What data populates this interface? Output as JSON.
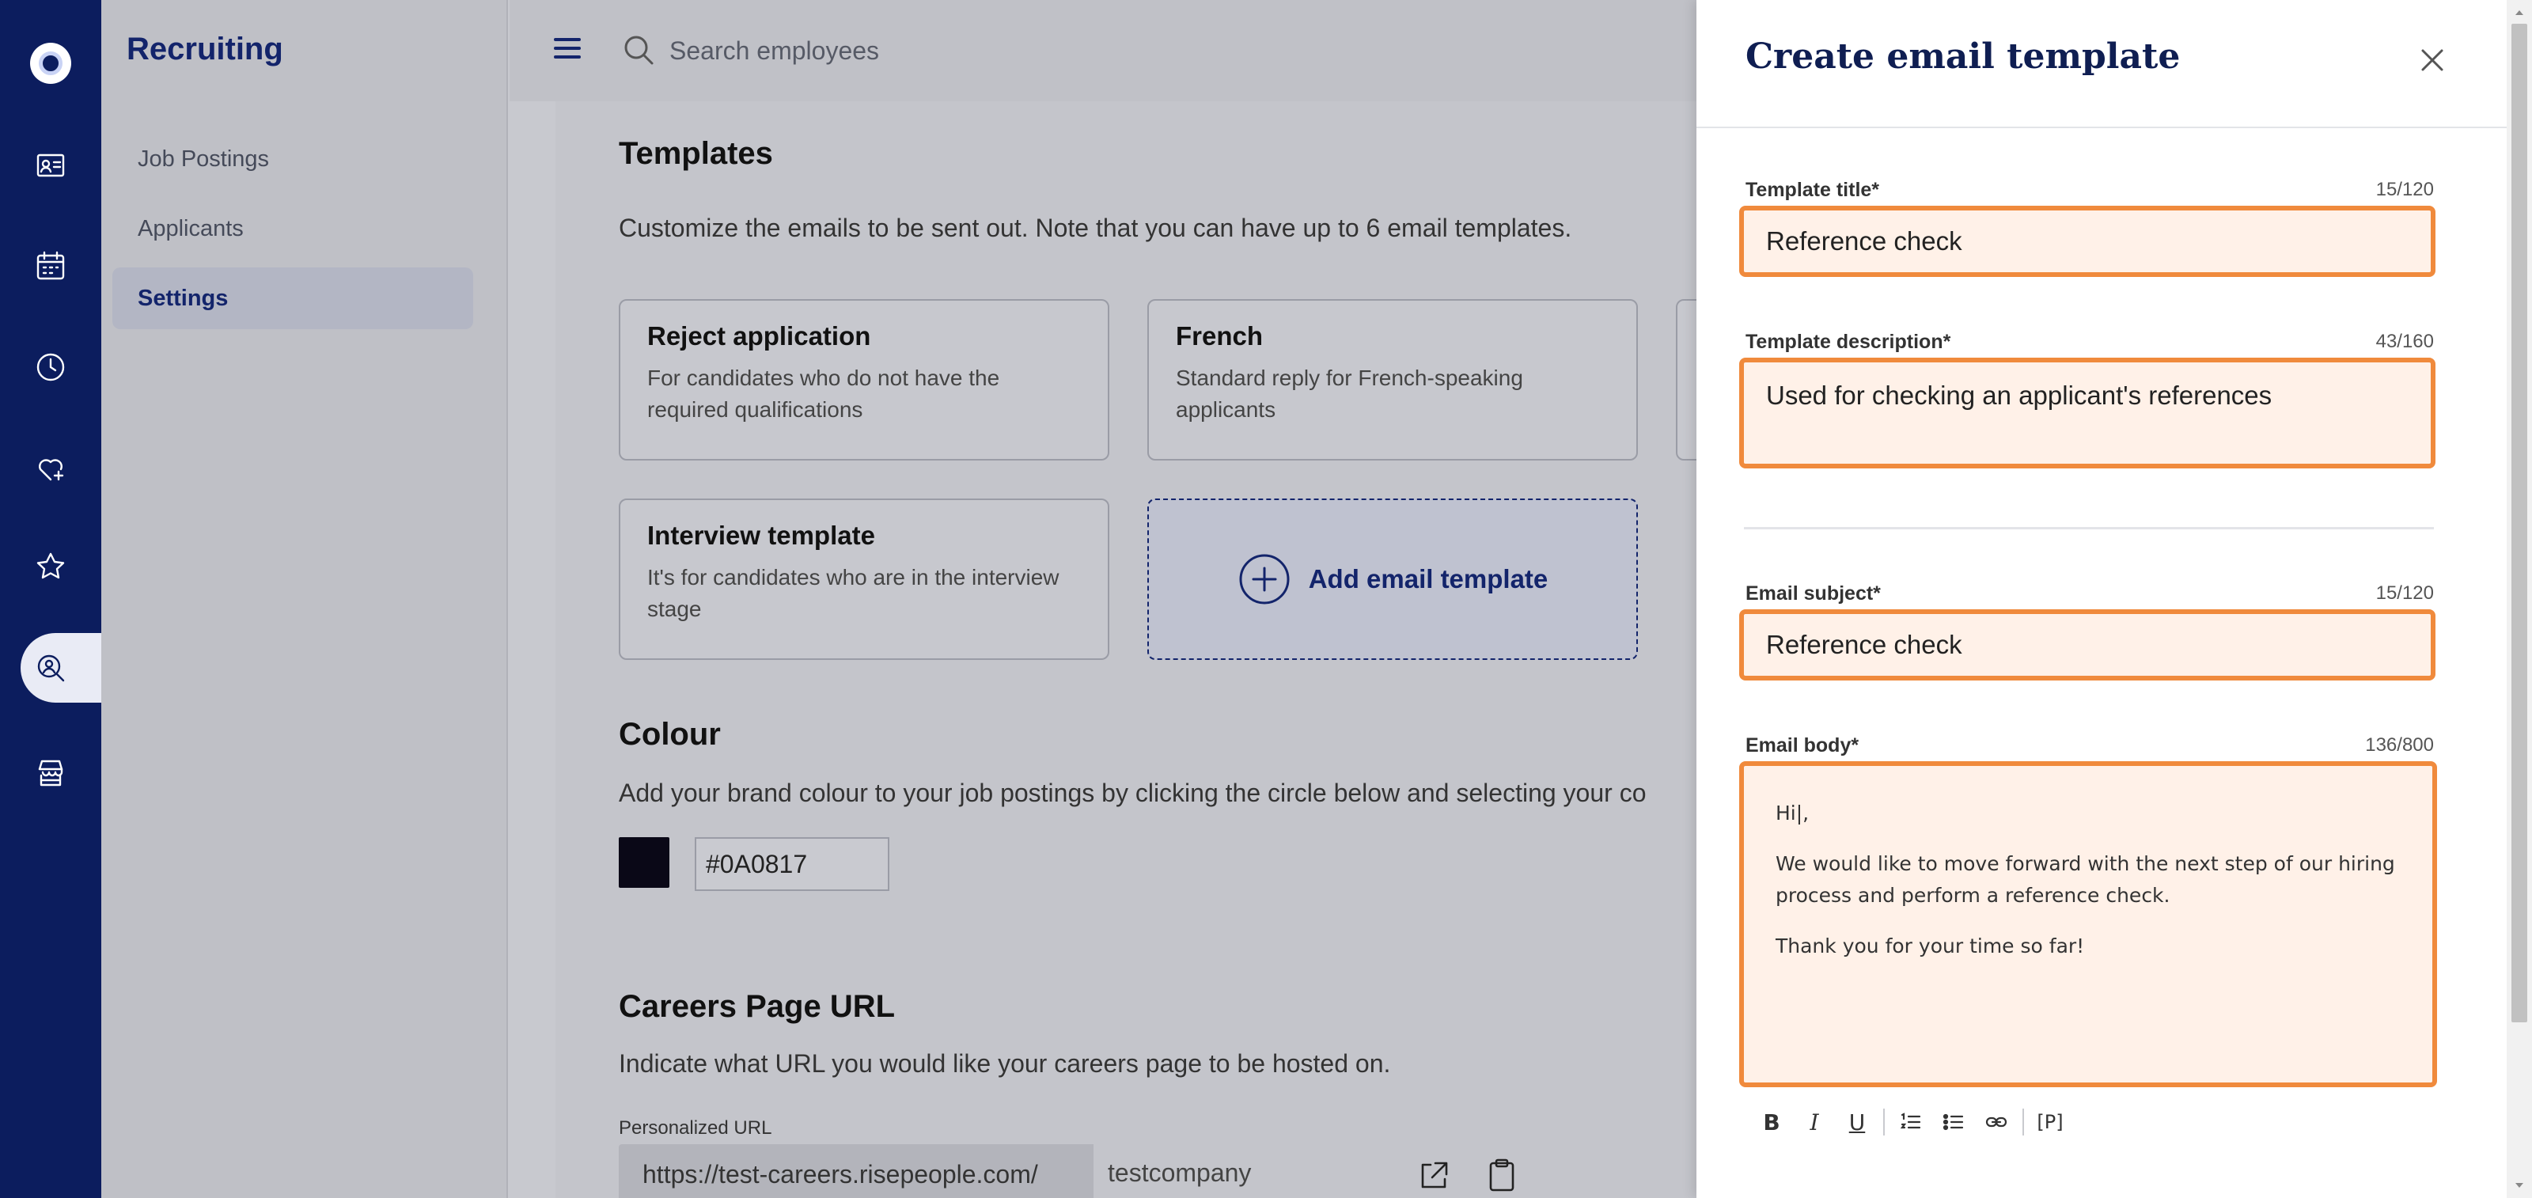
{
  "sidebar": {
    "title": "Recruiting",
    "items": [
      {
        "label": "Job Postings"
      },
      {
        "label": "Applicants"
      },
      {
        "label": "Settings"
      }
    ]
  },
  "search": {
    "placeholder": "Search employees"
  },
  "templates": {
    "heading": "Templates",
    "description": "Customize the emails to be sent out. Note that you can have up to 6 email templates.",
    "cards": [
      {
        "title": "Reject application",
        "description": "For candidates who do not have the required qualifications"
      },
      {
        "title": "French",
        "description": "Standard reply for French-speaking applicants"
      },
      {
        "title": "Interview template",
        "description": "It's for candidates who are in the interview stage"
      }
    ],
    "add_label": "Add email template"
  },
  "colour": {
    "heading": "Colour",
    "description": "Add your brand colour to your job postings by clicking the circle below and selecting your co",
    "value": "#0A0817"
  },
  "careers": {
    "heading": "Careers Page URL",
    "description": "Indicate what URL you would like your careers page to be hosted on.",
    "url_label": "Personalized URL",
    "url_prefix": "https://test-careers.risepeople.com/",
    "url_suffix": "testcompany"
  },
  "drawer": {
    "title": "Create email template",
    "template_title": {
      "label": "Template title*",
      "count": "15/120",
      "value": "Reference check"
    },
    "template_description": {
      "label": "Template description*",
      "count": "43/160",
      "value": "Used for checking an applicant's references"
    },
    "email_subject": {
      "label": "Email subject*",
      "count": "15/120",
      "value": "Reference check"
    },
    "email_body": {
      "label": "Email body*",
      "count": "136/800",
      "greeting": "Hi|,",
      "paragraph1": "We would like to move forward with the next step of our hiring process and perform a reference check.",
      "paragraph2": "Thank you for your time so far!"
    },
    "toolbar": {
      "bold": "B",
      "italic": "I",
      "underline": "U",
      "placeholder": "[P]"
    }
  },
  "colors": {
    "accent": "#f08a3c",
    "navy": "#0c1d5e",
    "field_bg": "#fff1e8"
  }
}
